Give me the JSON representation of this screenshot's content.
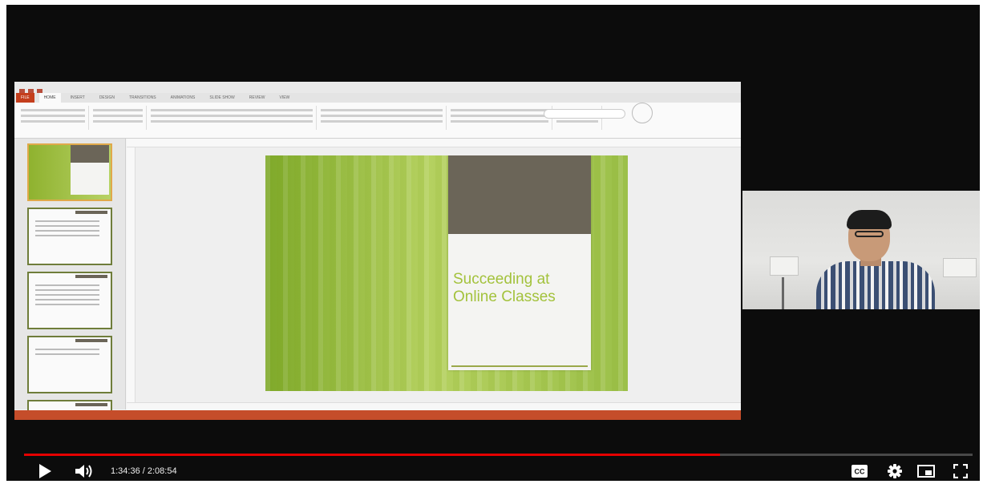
{
  "presentation": {
    "ribbon_tabs": [
      "FILE",
      "HOME",
      "INSERT",
      "DESIGN",
      "TRANSITIONS",
      "ANIMATIONS",
      "SLIDE SHOW",
      "REVIEW",
      "VIEW"
    ],
    "slide_title": "Succeeding at Online Classes"
  },
  "player": {
    "time_display": "1:34:36 / 2:08:54",
    "progress": 0.734,
    "progress_color": "#e50000",
    "status_color": "#c54d2a",
    "controls": {
      "play_icon": "play-icon",
      "volume_icon": "volume-icon",
      "captions_icon": "captions-icon",
      "settings_icon": "gear-icon",
      "miniplayer_icon": "miniplayer-icon",
      "fullscreen_icon": "fullscreen-icon"
    }
  }
}
